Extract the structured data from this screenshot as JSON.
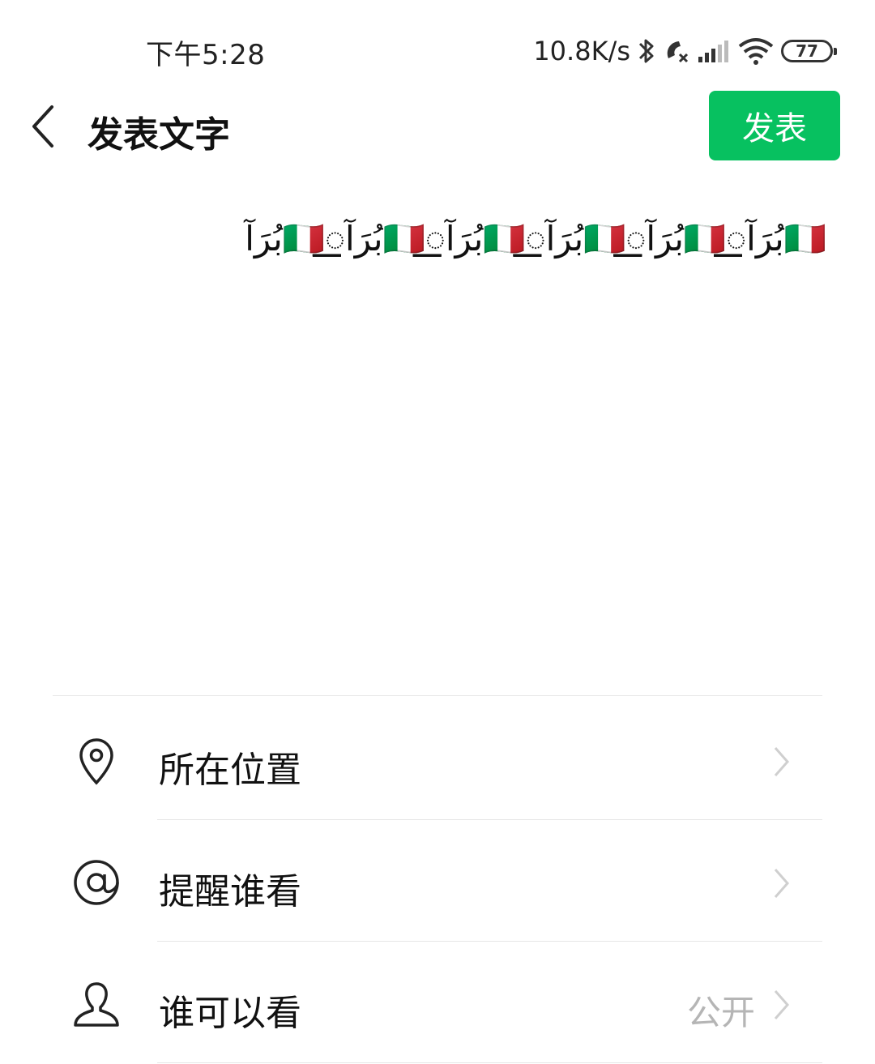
{
  "status_bar": {
    "time": "下午5:28",
    "net_speed": "10.8K/s",
    "battery": "77",
    "icons": [
      "bluetooth-icon",
      "call-forwarding-icon",
      "signal-icon",
      "wifi-icon",
      "battery-icon"
    ]
  },
  "nav": {
    "back_icon": "chevron-left-icon",
    "title": "发表文字",
    "publish_label": "发表",
    "accent_color": "#07c160"
  },
  "editor": {
    "text": "🇮🇹بُرَآ꯭꯭꯭꯭꯭꯭꯭꯭꯭🇮🇹بُرَآ꯭꯭꯭꯭꯭꯭꯭꯭꯭🇮🇹بُرَآ꯭꯭꯭꯭꯭꯭꯭꯭꯭🇮🇹بُرَآ꯭꯭꯭꯭꯭꯭꯭꯭꯭🇮🇹بُرَآ꯭꯭꯭꯭꯭꯭꯭꯭꯭🇮🇹بُرَآ"
  },
  "options": [
    {
      "icon": "location-pin-icon",
      "label": "所在位置",
      "value": ""
    },
    {
      "icon": "at-sign-icon",
      "label": "提醒谁看",
      "value": ""
    },
    {
      "icon": "person-icon",
      "label": "谁可以看",
      "value": "公开"
    }
  ]
}
